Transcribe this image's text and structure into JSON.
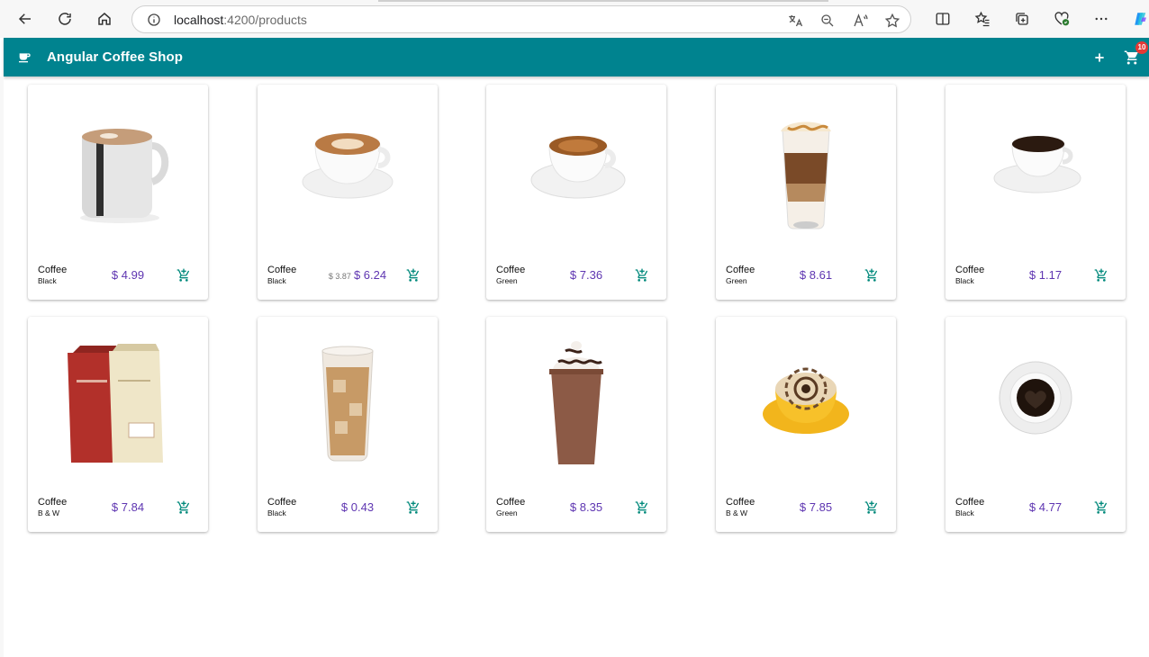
{
  "browser": {
    "url_host": "localhost",
    "url_rest": ":4200/products"
  },
  "app": {
    "title": "Angular Coffee Shop",
    "cart_count": "10"
  },
  "colors": {
    "header_bg": "#00838f",
    "price": "#5e35b1",
    "cart_icon": "#00897b",
    "badge": "#e53935"
  },
  "products": [
    {
      "name": "Coffee",
      "variant": "Black",
      "old_price": "",
      "price": "$ 4.99",
      "image": "mug-latte-icon"
    },
    {
      "name": "Coffee",
      "variant": "Black",
      "old_price": "$ 3.87",
      "price": "$ 6.24",
      "image": "cappuccino-cup-icon"
    },
    {
      "name": "Coffee",
      "variant": "Green",
      "old_price": "",
      "price": "$ 7.36",
      "image": "espresso-cup-icon"
    },
    {
      "name": "Coffee",
      "variant": "Green",
      "old_price": "",
      "price": "$ 8.61",
      "image": "latte-macchiato-glass-icon"
    },
    {
      "name": "Coffee",
      "variant": "Black",
      "old_price": "",
      "price": "$ 1.17",
      "image": "black-coffee-cup-icon"
    },
    {
      "name": "Coffee",
      "variant": "B & W",
      "old_price": "",
      "price": "$ 7.84",
      "image": "coffee-bags-icon"
    },
    {
      "name": "Coffee",
      "variant": "Black",
      "old_price": "",
      "price": "$ 0.43",
      "image": "iced-coffee-glass-icon"
    },
    {
      "name": "Coffee",
      "variant": "Green",
      "old_price": "",
      "price": "$ 8.35",
      "image": "frappe-cup-icon"
    },
    {
      "name": "Coffee",
      "variant": "B & W",
      "old_price": "",
      "price": "$ 7.85",
      "image": "yellow-cup-latte-art-icon"
    },
    {
      "name": "Coffee",
      "variant": "Black",
      "old_price": "",
      "price": "$ 4.77",
      "image": "heart-coffee-topview-icon"
    }
  ]
}
